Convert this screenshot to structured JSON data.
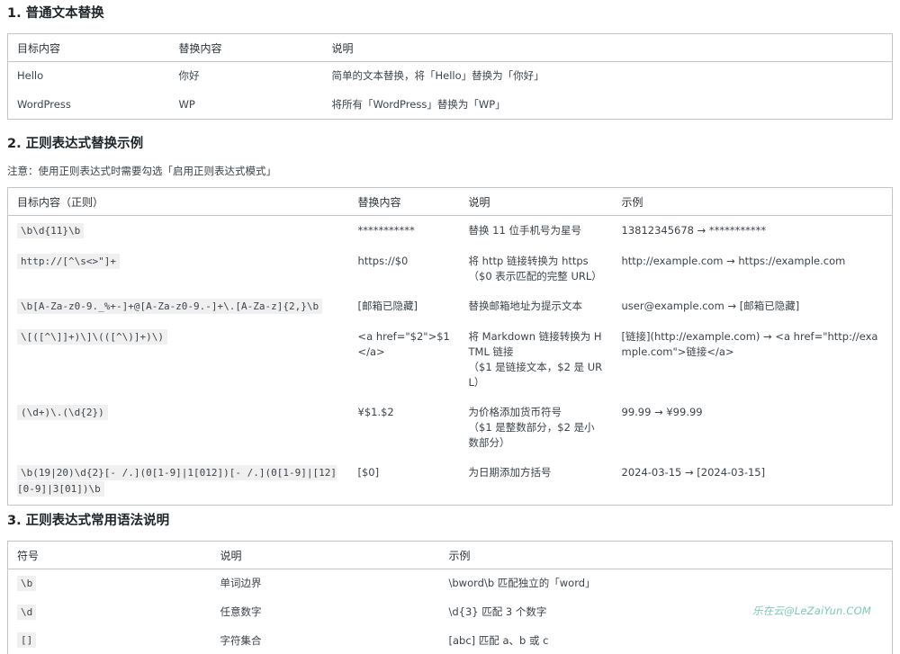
{
  "section1": {
    "title": "1. 普通文本替换",
    "headers": [
      "目标内容",
      "替换内容",
      "说明"
    ],
    "rows": [
      {
        "target": "Hello",
        "replace": "你好",
        "desc": "简单的文本替换，将「Hello」替换为「你好」"
      },
      {
        "target": "WordPress",
        "replace": "WP",
        "desc": "将所有「WordPress」替换为「WP」"
      }
    ]
  },
  "section2": {
    "title": "2. 正则表达式替换示例",
    "note": "注意：使用正则表达式时需要勾选「启用正则表达式模式」",
    "headers": [
      "目标内容（正则）",
      "替换内容",
      "说明",
      "示例"
    ],
    "rows": [
      {
        "target": "\\b\\d{11}\\b",
        "replace": "***********",
        "desc": "替换 11 位手机号为星号",
        "desc2": "",
        "example": "13812345678 → ***********"
      },
      {
        "target": "http://[^\\s<>\"]+",
        "replace": "https://$0",
        "desc": "将 http 链接转换为 https",
        "desc2": "（$0 表示匹配的完整 URL）",
        "example": "http://example.com → https://example.com"
      },
      {
        "target": "\\b[A-Za-z0-9._%+-]+@[A-Za-z0-9.-]+\\.[A-Za-z]{2,}\\b",
        "replace": "[邮箱已隐藏]",
        "desc": "替换邮箱地址为提示文本",
        "desc2": "",
        "example": "user@example.com → [邮箱已隐藏]"
      },
      {
        "target": "\\[([^\\]]+)\\]\\(([^\\)]+)\\)",
        "replace": "<a href=\"$2\">$1</a>",
        "desc": "将 Markdown 链接转换为 HTML 链接",
        "desc2": "（$1 是链接文本，$2 是 URL）",
        "example": "[链接](http://example.com) → <a href=\"http://example.com\">链接</a>"
      },
      {
        "target": "(\\d+)\\.(\\d{2})",
        "replace": "¥$1.$2",
        "desc": "为价格添加货币符号",
        "desc2": "（$1 是整数部分，$2 是小数部分）",
        "example": "99.99 → ¥99.99"
      },
      {
        "target": "\\b(19|20)\\d{2}[- /.](0[1-9]|1[012])[- /.](0[1-9]|[12][0-9]|3[01])\\b",
        "replace": "[$0]",
        "desc": "为日期添加方括号",
        "desc2": "",
        "example": "2024-03-15 → [2024-03-15]"
      }
    ]
  },
  "section3": {
    "title": "3. 正则表达式常用语法说明",
    "headers": [
      "符号",
      "说明",
      "示例"
    ],
    "rows": [
      {
        "symbol": "\\b",
        "desc": "单词边界",
        "example": "\\bword\\b 匹配独立的「word」"
      },
      {
        "symbol": "\\d",
        "desc": "任意数字",
        "example": "\\d{3} 匹配 3 个数字"
      },
      {
        "symbol": "[]",
        "desc": "字符集合",
        "example": "[abc] 匹配 a、b 或 c"
      }
    ]
  },
  "watermark": "乐在云@LeZaiYun.COM"
}
